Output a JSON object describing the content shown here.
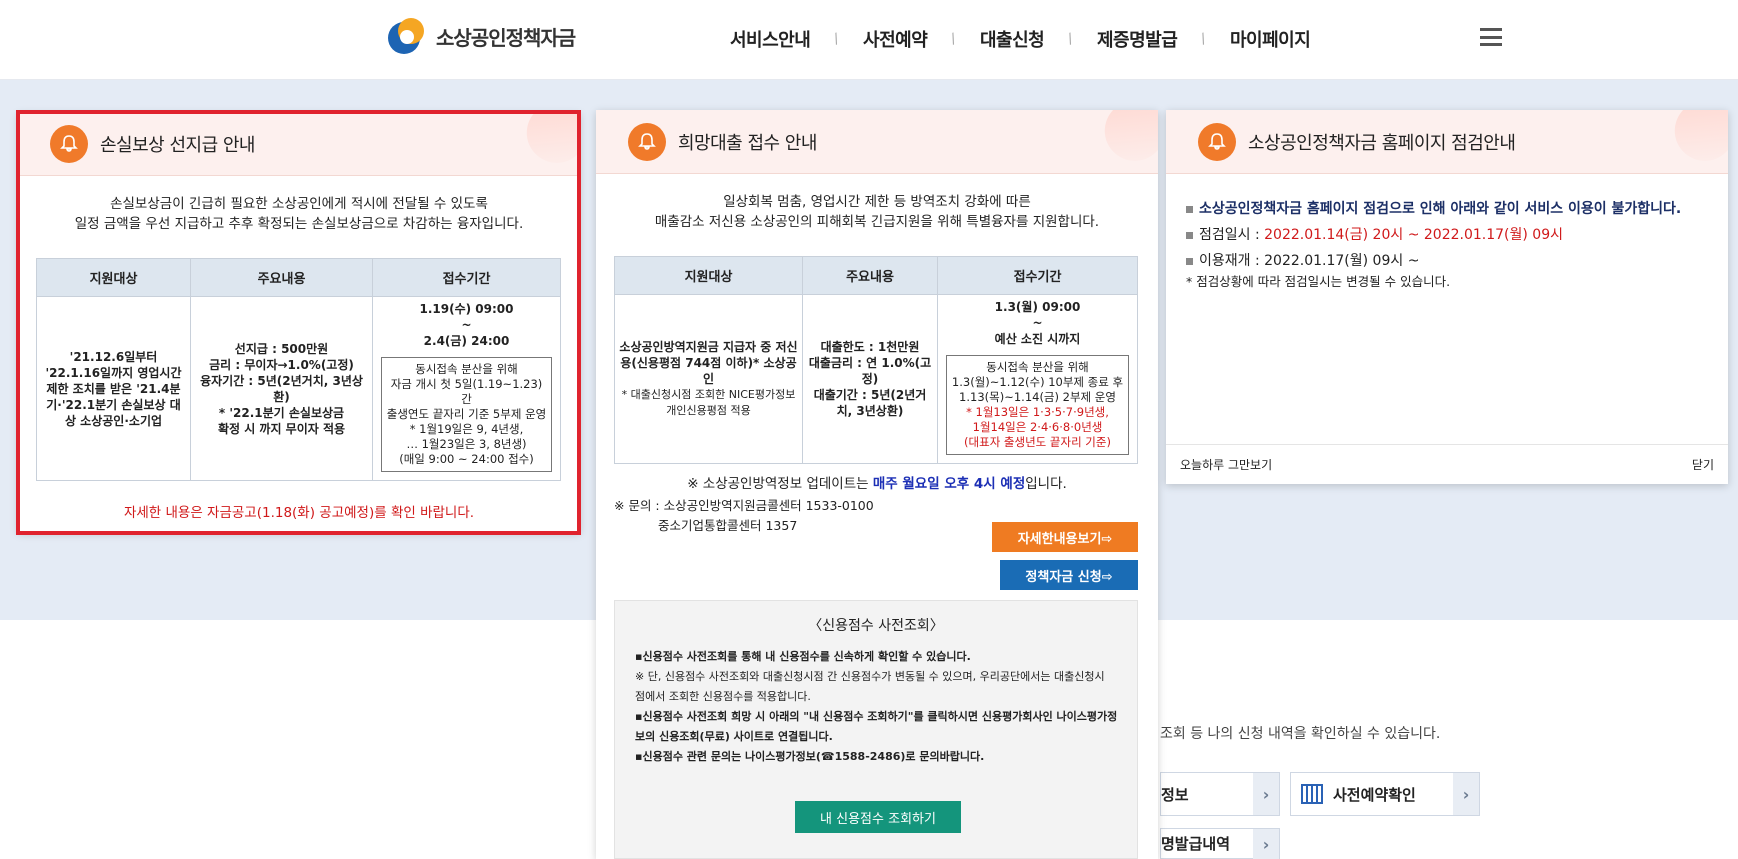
{
  "header": {
    "logo_text": "소상공인정책자금",
    "nav": [
      "서비스안내",
      "사전예약",
      "대출신청",
      "제증명발급",
      "마이페이지"
    ]
  },
  "background": {
    "mypage_text": "조회 등 나의 신청 내역을 확인하실 수 있습니다.",
    "buttons": [
      "정보",
      "사전예약확인",
      "명발급내역"
    ]
  },
  "popup1": {
    "title": "손실보상 선지급 안내",
    "intro": [
      "손실보상금이 긴급히 필요한 소상공인에게 적시에 전달될 수 있도록",
      "일정 금액을 우선 지급하고 추후 확정되는 손실보상금으로 차감하는 융자입니다."
    ],
    "headers": [
      "지원대상",
      "주요내용",
      "접수기간"
    ],
    "target": "'21.12.6일부터 '22.1.16일까지 영업시간 제한 조치를 받은 '21.4분기·'22.1분기 손실보상 대상 소상공인·소기업",
    "content": [
      "선지급 : 500만원",
      "금리 : 무이자→1.0%(고정)",
      "융자기간 : 5년(2년거치, 3년상환)",
      "* '22.1분기 손실보상금",
      "확정 시 까지 무이자 적용"
    ],
    "period": [
      "1.19(수) 09:00",
      "~",
      "2.4(금) 24:00"
    ],
    "period_note": [
      "동시접속 분산을 위해",
      "자금 개시 첫 5일(1.19~1.23)간",
      "출생연도 끝자리 기준 5부제 운영",
      "* 1월19일은 9, 4년생,",
      "… 1월23일은 3, 8년생)",
      "(매일 9:00 ~ 24:00 접수)"
    ],
    "note": "자세한 내용은 자금공고(1.18(화) 공고예정)를 확인 바랍니다."
  },
  "popup2": {
    "title": "희망대출 접수 안내",
    "intro": [
      "일상회복 멈춤, 영업시간 제한 등 방역조치 강화에 따른",
      "매출감소 저신용 소상공인의 피해회복 긴급지원을 위해 특별융자를 지원합니다."
    ],
    "headers": [
      "지원대상",
      "주요내용",
      "접수기간"
    ],
    "target": [
      "소상공인방역지원금 지급자 중 저신용(신용평점 744점 이하)* 소상공인",
      "* 대출신청시점 조회한 NICE평가정보 개인신용평점 적용"
    ],
    "content": [
      "대출한도 : 1천만원",
      "대출금리 : 연 1.0%(고정)",
      "대출기간 : 5년(2년거치, 3년상환)"
    ],
    "period": [
      "1.3(월) 09:00",
      "~",
      "예산 소진 시까지"
    ],
    "period_note": [
      "동시접속 분산을 위해",
      "1.3(월)~1.12(수) 10부제 종료 후",
      "1.13(목)~1.14(금) 2부제 운영"
    ],
    "period_note_red": [
      "* 1월13일은 1·3·5·7·9년생,",
      "1월14일은 2·4·6·8·0년생",
      "(대표자 출생년도 끝자리 기준)"
    ],
    "update_pre": "※ 소상공인방역정보 업데이트는 ",
    "update_bold": "매주 월요일 오후 4시 예정",
    "update_post": "입니다.",
    "contact1": "※ 문의 : 소상공인방역지원금콜센터 1533-0100",
    "contact2": "중소기업통합콜센터 1357",
    "btn_detail": "자세한내용보기⇨",
    "btn_apply": "정책자금 신청⇨",
    "credit_title": "〈신용점수 사전조회〉",
    "credit_lines": [
      "▪신용점수 사전조회를 통해 내 신용점수를 신속하게 확인할 수 있습니다.",
      "※ 단, 신용점수 사전조회와 대출신청시점 간 신용점수가 변동될 수 있으며, 우리공단에서는 대출신청시",
      "점에서 조회한 신용점수를 적용합니다.",
      "▪신용점수 사전조회 희망 시 아래의 \"내 신용점수 조회하기\"를 클릭하시면 신용평가회사인 나이스평가정",
      "보의 신용조회(무료) 사이트로 연결됩니다.",
      "▪신용점수 관련 문의는 나이스평가정보(☎1588-2486)로 문의바랍니다."
    ],
    "credit_btn": "내 신용점수 조회하기"
  },
  "popup3": {
    "title": "소상공인정책자금 홈페이지 점검안내",
    "line1": "소상공인정책자금 홈페이지 점검으로 인해 아래와 같이 서비스 이용이 불가합니다.",
    "line2_label": "점검일시 : ",
    "line2_value": "2022.01.14(금) 20시 ~ 2022.01.17(월) 09시",
    "line3": "이용재개 : 2022.01.17(월) 09시 ~",
    "line4": "* 점검상황에 따라 점검일시는 변경될 수 있습니다.",
    "footer_left": "오늘하루 그만보기",
    "footer_right": "닫기"
  }
}
